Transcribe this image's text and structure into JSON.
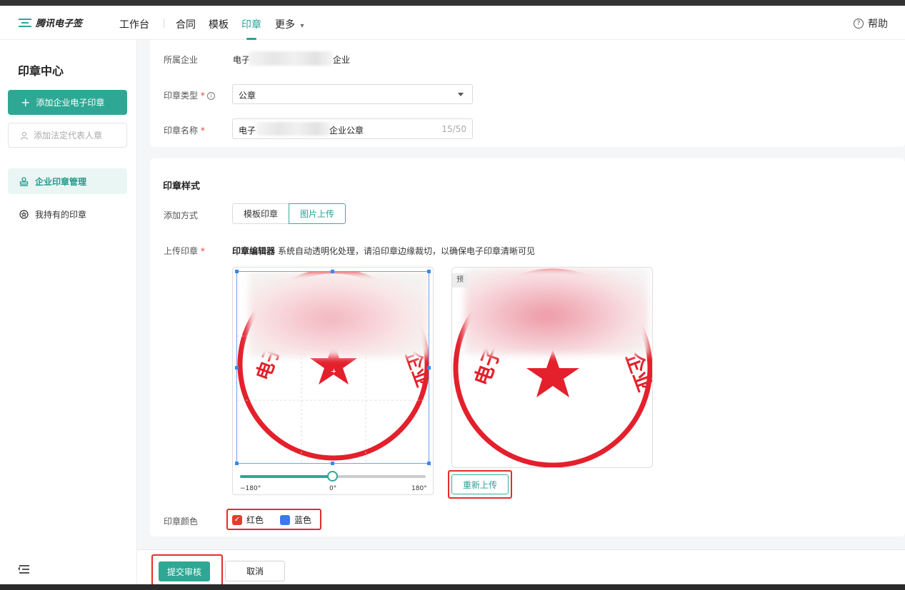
{
  "nav": {
    "logo_text": "腾讯电子签",
    "items": [
      "工作台",
      "合同",
      "模板",
      "印章",
      "更多"
    ],
    "more_caret": "▾",
    "help": "帮助",
    "accent": "#29a394"
  },
  "sidebar": {
    "title": "印章中心",
    "add_company_seal": "添加企业电子印章",
    "add_legal_rep_seal": "添加法定代表人章",
    "items": [
      "企业印章管理",
      "我持有的印章"
    ]
  },
  "form": {
    "company_label": "所属企业",
    "company_value_prefix": "电子",
    "company_value_suffix": "企业",
    "seal_type_label": "印章类型",
    "required_mark": "*",
    "info_mark": "i",
    "seal_type_value": "公章",
    "seal_name_label": "印章名称",
    "seal_name_prefix": "电子",
    "seal_name_suffix": "企业公章",
    "seal_name_count": "15/50"
  },
  "style": {
    "section_title": "印章样式",
    "add_method_label": "添加方式",
    "tabs": [
      "模板印章",
      "图片上传"
    ],
    "selected_tab": "图片上传",
    "upload_label": "上传印章",
    "editor_title": "印章编辑器",
    "editor_hint": "系统自动透明化处理，请沿印章边缘裁切，以确保电子印章清晰可见",
    "rotation_min": "−180°",
    "rotation_mid": "0°",
    "rotation_max": "180°",
    "rotation_value_deg": 0,
    "preview_tag": "预",
    "seal_char_left": "电子",
    "seal_char_right": "企业",
    "reupload": "重新上传",
    "color_label": "印章颜色",
    "colors": [
      {
        "name": "红色",
        "hex": "#e53b2f",
        "checked": true
      },
      {
        "name": "蓝色",
        "hex": "#3c78ee",
        "checked": false
      }
    ],
    "seal_color": "#e3202c"
  },
  "footer": {
    "submit": "提交审核",
    "cancel": "取消"
  },
  "icons": [
    "logo-icon",
    "help-icon",
    "plus-icon",
    "user-icon",
    "stamp-icon",
    "badge-icon",
    "info-icon",
    "caret-down-icon",
    "collapse-menu-icon",
    "check-icon"
  ]
}
